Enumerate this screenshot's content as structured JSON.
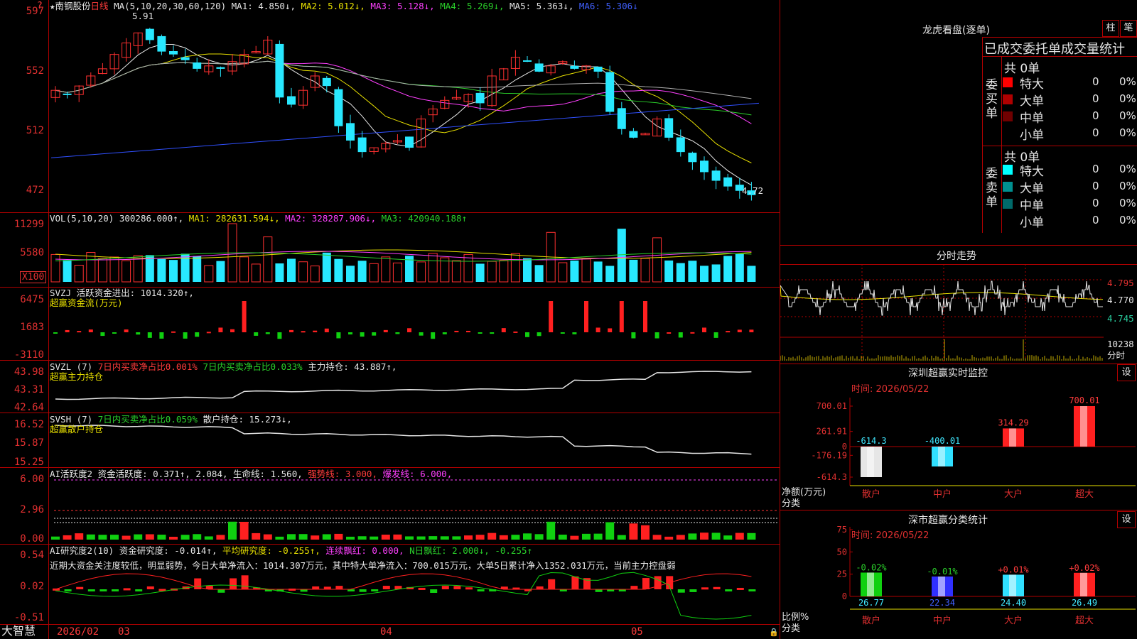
{
  "app": {
    "brand": "大智慧"
  },
  "chart_header": {
    "stock": "★南钢股份",
    "period": "日线",
    "ma_label": "MA(5,10,20,30,60,120)",
    "ma1": "MA1: 4.850↓,",
    "ma2": "MA2: 5.012↓,",
    "ma3": "MA3: 5.128↓,",
    "ma4": "MA4: 5.269↓,",
    "ma5": "MA5: 5.363↓,",
    "ma6": "MA6: 5.306↓",
    "high_mark": "5.91",
    "low_mark": "4.72"
  },
  "price_axis": [
    "597",
    "552",
    "512",
    "472"
  ],
  "vol": {
    "label": "VOL(5,10,20)",
    "value": "300286.000↑,",
    "ma1": "MA1: 282631.594↓,",
    "ma2": "MA2: 328287.906↓,",
    "ma3": "MA3: 420940.188↑",
    "axis": [
      "11299",
      "5580"
    ],
    "unit": "X100"
  },
  "svzj": {
    "label": "SVZJ  活跃资金进出: 1014.320↑,",
    "sub": "超赢资金流(万元)",
    "axis": [
      "6475",
      "1683",
      "-3110"
    ]
  },
  "svzl": {
    "label": "SVZL (7)",
    "p1": "7日内买卖净占比0.001%",
    "p2": "7日内买卖净占比0.033%",
    "p3": "主力持仓: 43.887↑,",
    "sub": "超赢主力持仓",
    "axis": [
      "43.98",
      "43.31",
      "42.64"
    ]
  },
  "svsh": {
    "label": "SVSH (7)",
    "p1": "7日内买卖净占比0.059%",
    "p2": "散户持仓: 15.273↓,",
    "sub": "超赢散户持仓",
    "axis": [
      "16.52",
      "15.87",
      "15.25"
    ]
  },
  "ai_active": {
    "label": "AI活跃度2 资金活跃度: 0.371↑, 2.084, 生命线: 1.560,",
    "strong": "强势线: 3.000,",
    "burst": "爆发线: 6.000,",
    "axis": [
      "6.00",
      "2.96",
      "0.00"
    ]
  },
  "ai_research": {
    "label": "AI研究度2(10)",
    "p1": "资金研究度: -0.014↑,",
    "p2": "平均研究度: -0.255↑,",
    "p3": "连续飘红: 0.000,",
    "p4": "N日飘红: 2.000↓, -0.255↑",
    "comment": "近期大资金关注度较低，明显弱势，今日大单净流入：1014.307万元，其中特大单净流入：700.015万元，大单5日累计净入1352.031万元，当前主力控盘弱",
    "axis": [
      "0.54",
      "0.02",
      "-0.51"
    ]
  },
  "date_axis": [
    "2026/02",
    "03",
    "04",
    "05"
  ],
  "dragon": {
    "title": "龙虎看盘(逐单)",
    "btn1": "柱",
    "btn2": "笔",
    "tabs": "已成交委托单成交量统计",
    "buy_side": "委买单",
    "sell_side": "委卖单",
    "buy_total": "共 0单",
    "sell_total": "共 0单",
    "buy_rows": [
      {
        "label": "特大",
        "count": "0",
        "pct": "0%",
        "color": "#ff0000"
      },
      {
        "label": "大单",
        "count": "0",
        "pct": "0%",
        "color": "#b00000"
      },
      {
        "label": "中单",
        "count": "0",
        "pct": "0%",
        "color": "#700000"
      },
      {
        "label": "小单",
        "count": "0",
        "pct": "0%",
        "color": "#000000"
      }
    ],
    "sell_rows": [
      {
        "label": "特大",
        "count": "0",
        "pct": "0%",
        "color": "#00ffff"
      },
      {
        "label": "大单",
        "count": "0",
        "pct": "0%",
        "color": "#009090"
      },
      {
        "label": "中单",
        "count": "0",
        "pct": "0%",
        "color": "#006a6a"
      },
      {
        "label": "小单",
        "count": "0",
        "pct": "0%",
        "color": "#000000"
      }
    ]
  },
  "intraday": {
    "title": "分时走势",
    "price_axis": [
      "4.795",
      "4.770",
      "4.745"
    ],
    "vol_axis": "10238",
    "vol_label": "分时"
  },
  "monitor": {
    "title": "深圳超赢实时监控",
    "btn": "设",
    "date": "时间: 2026/05/22",
    "axis": [
      "700.01",
      "261.91",
      "0",
      "-176.19",
      "-614.3"
    ],
    "ylabel": "净额(万元)",
    "xlabel": "分类",
    "chart_data": {
      "type": "bar",
      "categories": [
        "散户",
        "中户",
        "大户",
        "超大"
      ],
      "values": [
        -614.3,
        -400.01,
        314.29,
        700.01
      ],
      "value_labels": [
        "-614.3",
        "-400.01",
        "314.29",
        "700.01"
      ],
      "ylabel": "净额(万元)",
      "xlabel": "分类"
    }
  },
  "classify": {
    "title": "深市超赢分类统计",
    "btn": "设",
    "date": "时间: 2026/05/22",
    "axis": [
      "75",
      "50",
      "25",
      "0"
    ],
    "ylabel": "比例%",
    "xlabel": "分类",
    "chart_data": {
      "type": "bar",
      "categories": [
        "散户",
        "中户",
        "大户",
        "超大"
      ],
      "values": [
        26.77,
        22.34,
        24.4,
        26.49
      ],
      "changes": [
        "-0.02%",
        "-0.01%",
        "+0.01%",
        "+0.02%"
      ],
      "value_labels": [
        "26.77",
        "22.34",
        "24.40",
        "26.49"
      ],
      "ylabel": "比例%",
      "xlabel": "分类",
      "ylim": [
        0,
        75
      ]
    }
  }
}
